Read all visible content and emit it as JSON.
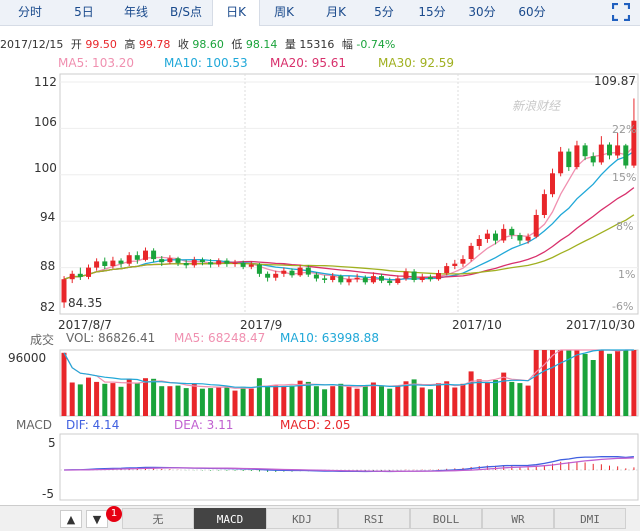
{
  "tabs": [
    {
      "label": "分时"
    },
    {
      "label": "5日"
    },
    {
      "label": "年线"
    },
    {
      "label": "B/S点"
    },
    {
      "label": "日K"
    },
    {
      "label": "周K"
    },
    {
      "label": "月K"
    },
    {
      "label": "5分"
    },
    {
      "label": "15分"
    },
    {
      "label": "30分"
    },
    {
      "label": "60分"
    }
  ],
  "active_tab": "日K",
  "info": {
    "date": "2017/12/15",
    "open_label": "开",
    "open": "99.50",
    "high_label": "高",
    "high": "99.78",
    "close_label": "收",
    "close": "98.60",
    "low_label": "低",
    "low": "98.14",
    "volume_label": "量",
    "volume": "15316",
    "change_label": "幅",
    "change": "-0.74%"
  },
  "ma": {
    "ma5": "MA5: 103.20",
    "ma10": "MA10: 100.53",
    "ma20": "MA20: 95.61",
    "ma30": "MA30: 92.59"
  },
  "colors": {
    "up": "#e8262a",
    "down": "#1aa33b",
    "ma5": "#f090b0",
    "ma10": "#20a8d8",
    "ma20": "#d8306c",
    "ma30": "#a0b020",
    "dif": "#4060e0",
    "dea": "#c060d0",
    "tab_text": "#1a4a8c"
  },
  "watermark": "新浪财经",
  "price_axis": {
    "left_ticks": [
      "112",
      "106",
      "100",
      "94",
      "88",
      "82"
    ],
    "right_ticks": [
      "22%",
      "15%",
      "8%",
      "1%",
      "-6%"
    ],
    "max_label": "109.87",
    "min_label": "84.35"
  },
  "date_labels": [
    "2017/8/7",
    "2017/9",
    "2017/10",
    "2017/10/30"
  ],
  "volume_info": {
    "title": "成交",
    "vol": "VOL: 86826.41",
    "ma5": "MA5: 68248.47",
    "ma10": "MA10: 63998.88",
    "axis_max": "96000"
  },
  "macd_info": {
    "title": "MACD",
    "dif": "DIF: 4.14",
    "dea": "DEA: 3.11",
    "macd": "MACD: 2.05",
    "ticks": [
      "5",
      "-5"
    ]
  },
  "indicator_tabs": [
    "无",
    "MACD",
    "KDJ",
    "RSI",
    "BOLL",
    "WR",
    "DMI"
  ],
  "active_indicator": "MACD",
  "arrows": {
    "up": "▲",
    "down": "▼"
  },
  "notification_count": "1",
  "chart_data": {
    "type": "candlestick",
    "period": "daily",
    "ylim": [
      82,
      112
    ],
    "candles": [
      [
        83.5,
        86.5,
        82.8,
        86.9
      ],
      [
        86.5,
        87.2,
        86.0,
        87.6
      ],
      [
        87.2,
        86.8,
        86.4,
        88.0
      ],
      [
        86.8,
        88.0,
        86.5,
        88.4
      ],
      [
        88.0,
        88.8,
        87.6,
        89.2
      ],
      [
        88.8,
        88.2,
        87.8,
        89.3
      ],
      [
        88.2,
        88.9,
        87.9,
        89.4
      ],
      [
        88.9,
        88.5,
        88.0,
        89.2
      ],
      [
        88.5,
        89.6,
        88.2,
        90.0
      ],
      [
        89.6,
        89.0,
        88.5,
        90.1
      ],
      [
        89.0,
        90.2,
        88.8,
        90.6
      ],
      [
        90.2,
        89.1,
        88.7,
        90.5
      ],
      [
        89.1,
        88.7,
        88.2,
        89.5
      ],
      [
        88.7,
        89.2,
        88.4,
        89.6
      ],
      [
        89.2,
        88.6,
        88.2,
        89.4
      ],
      [
        88.6,
        88.3,
        87.9,
        89.0
      ],
      [
        88.3,
        89.0,
        88.0,
        89.4
      ],
      [
        89.0,
        88.7,
        88.3,
        89.3
      ],
      [
        88.7,
        88.4,
        88.0,
        89.1
      ],
      [
        88.4,
        88.9,
        88.1,
        89.2
      ],
      [
        88.9,
        88.5,
        88.1,
        89.2
      ],
      [
        88.5,
        88.6,
        88.1,
        89.0
      ],
      [
        88.6,
        88.1,
        87.8,
        88.9
      ],
      [
        88.1,
        88.4,
        87.8,
        88.8
      ],
      [
        88.4,
        87.2,
        86.8,
        88.6
      ],
      [
        87.2,
        86.7,
        86.2,
        87.5
      ],
      [
        86.7,
        87.2,
        86.3,
        87.6
      ],
      [
        87.2,
        87.6,
        86.8,
        88.0
      ],
      [
        87.6,
        87.0,
        86.7,
        87.9
      ],
      [
        87.0,
        88.0,
        86.8,
        88.4
      ],
      [
        88.0,
        87.1,
        86.8,
        88.3
      ],
      [
        87.1,
        86.6,
        86.2,
        87.4
      ],
      [
        86.6,
        86.4,
        86.0,
        87.0
      ],
      [
        86.4,
        86.9,
        86.1,
        87.3
      ],
      [
        86.9,
        86.1,
        85.8,
        87.1
      ],
      [
        86.1,
        86.5,
        85.7,
        86.9
      ],
      [
        86.5,
        86.7,
        86.1,
        87.2
      ],
      [
        86.7,
        86.1,
        85.8,
        87.0
      ],
      [
        86.1,
        86.9,
        85.9,
        87.4
      ],
      [
        86.9,
        86.3,
        86.0,
        87.2
      ],
      [
        86.3,
        86.0,
        85.7,
        86.7
      ],
      [
        86.0,
        86.6,
        85.8,
        87.0
      ],
      [
        86.6,
        87.5,
        86.3,
        87.9
      ],
      [
        87.5,
        86.4,
        86.1,
        87.8
      ],
      [
        86.4,
        86.8,
        86.1,
        87.2
      ],
      [
        86.8,
        86.5,
        86.2,
        87.1
      ],
      [
        86.5,
        87.3,
        86.3,
        87.7
      ],
      [
        87.3,
        88.2,
        87.0,
        88.6
      ],
      [
        88.2,
        88.5,
        87.8,
        89.0
      ],
      [
        88.5,
        89.1,
        88.1,
        89.6
      ],
      [
        89.1,
        90.8,
        88.8,
        91.2
      ],
      [
        90.8,
        91.7,
        90.3,
        92.2
      ],
      [
        91.7,
        92.4,
        91.2,
        92.9
      ],
      [
        92.4,
        91.5,
        91.0,
        92.8
      ],
      [
        91.5,
        93.0,
        91.2,
        93.6
      ],
      [
        93.0,
        92.2,
        91.7,
        93.3
      ],
      [
        92.2,
        91.5,
        91.0,
        92.5
      ],
      [
        91.5,
        92.0,
        91.1,
        92.4
      ],
      [
        92.0,
        94.8,
        91.8,
        95.5
      ],
      [
        94.8,
        97.5,
        94.4,
        98.1
      ],
      [
        97.5,
        100.2,
        97.1,
        100.8
      ],
      [
        100.2,
        103.0,
        99.8,
        103.6
      ],
      [
        103.0,
        101.0,
        100.5,
        103.4
      ],
      [
        101.0,
        103.8,
        100.7,
        104.4
      ],
      [
        103.8,
        102.4,
        101.9,
        104.1
      ],
      [
        102.4,
        101.6,
        101.1,
        102.9
      ],
      [
        101.6,
        103.9,
        101.3,
        105.0
      ],
      [
        103.9,
        102.5,
        102.0,
        104.2
      ],
      [
        102.5,
        103.8,
        102.1,
        105.4
      ],
      [
        103.8,
        101.2,
        100.8,
        104.0
      ],
      [
        101.2,
        107.0,
        100.9,
        109.87
      ]
    ]
  }
}
